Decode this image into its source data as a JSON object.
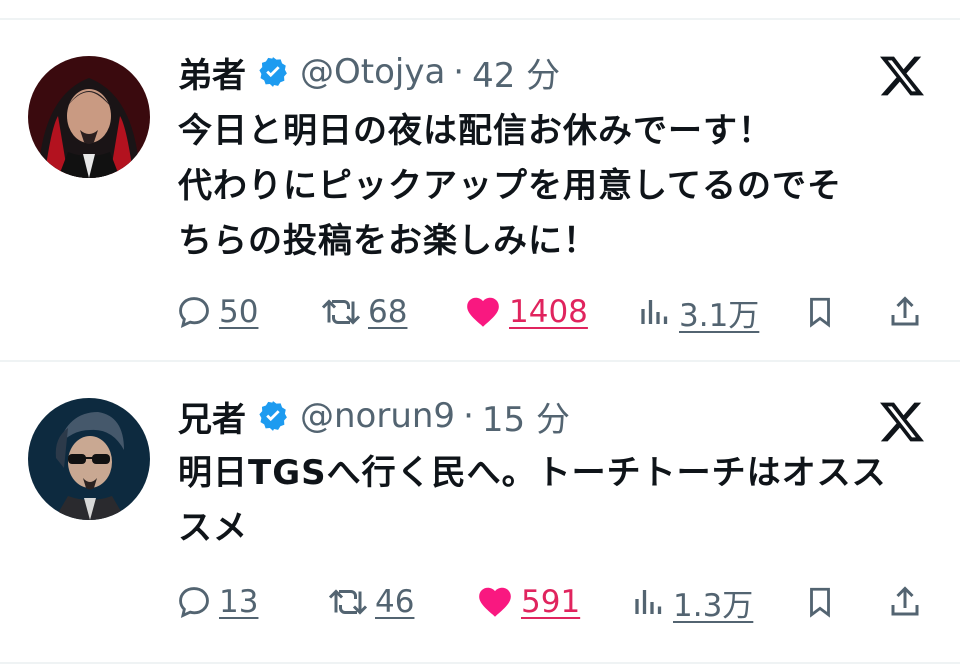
{
  "colors": {
    "text": "#0f1419",
    "secondary": "#536471",
    "like": "#f91880",
    "verified": "#1d9bf0",
    "divider": "#eff3f4"
  },
  "tweets": [
    {
      "name": "弟者",
      "handle": "@Otojya",
      "time": "42 分",
      "lines": [
        "今日と明日の夜は配信お休みでーす！",
        "代わりにピックアップを用意してるのでそ",
        "ちらの投稿をお楽しみに！"
      ],
      "replies": "50",
      "retweets": "68",
      "likes": "1408",
      "views": "3.1万"
    },
    {
      "name": "兄者",
      "handle": "@norun9",
      "time": "15 分",
      "lines": [
        "明日TGSへ行く民へ。トーチトーチはオスス",
        "スメ"
      ],
      "replies": "13",
      "retweets": "46",
      "likes": "591",
      "views": "1.3万"
    }
  ],
  "icons": [
    "verified-badge-icon",
    "x-logo-icon",
    "reply-icon",
    "retweet-icon",
    "heart-icon",
    "views-icon",
    "bookmark-icon",
    "share-icon"
  ]
}
